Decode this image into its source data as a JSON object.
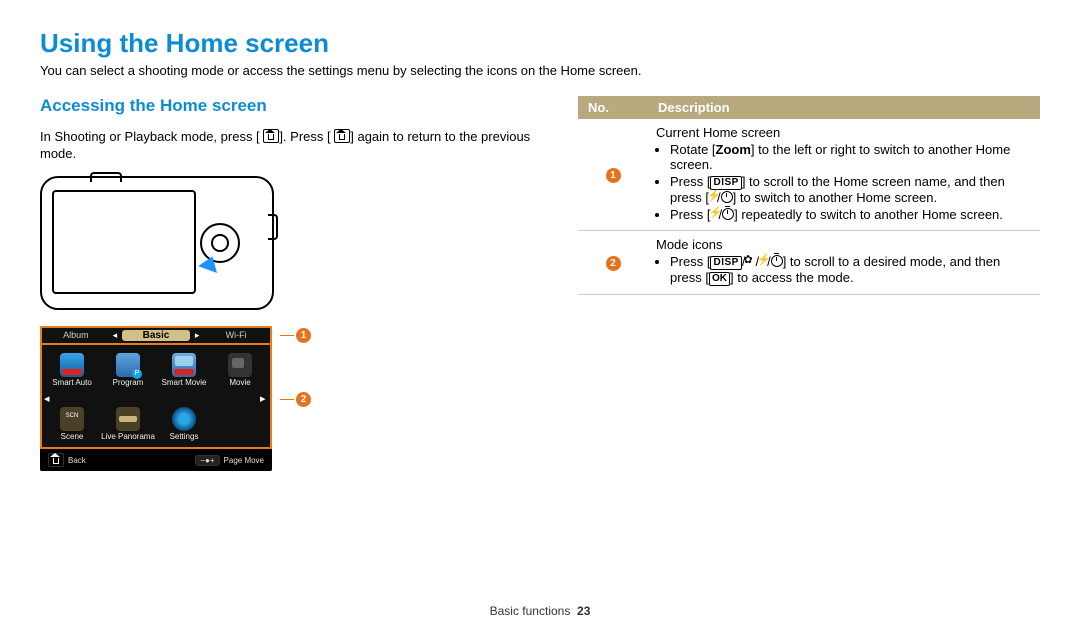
{
  "title": "Using the Home screen",
  "intro": "You can select a shooting mode or access the settings menu by selecting the icons on the Home screen.",
  "section_heading": "Accessing the Home screen",
  "access_text": {
    "pre": "In Shooting or Playback mode, press [",
    "mid": "]. Press [",
    "post": "] again to return to the previous mode."
  },
  "callouts": [
    "1",
    "2"
  ],
  "home_screen": {
    "tabs": [
      "Album",
      "Basic",
      "Wi-Fi"
    ],
    "row1": [
      "Smart Auto",
      "Program",
      "Smart Movie",
      "Movie"
    ],
    "row2": [
      "Scene",
      "Live\nPanorama",
      "Settings"
    ],
    "footer": {
      "back": "Back",
      "page_move": "Page Move"
    }
  },
  "symbols": {
    "disp": "DISP",
    "ok": "OK"
  },
  "table": {
    "headers": [
      "No.",
      "Description"
    ],
    "rows": [
      {
        "no": "1",
        "title": "Current Home screen",
        "b1a": "Rotate [",
        "zoom": "Zoom",
        "b1b": "] to the left or right to switch to another Home screen.",
        "b2a": "Press [",
        "b2b": "] to scroll to the Home screen name, and then press [",
        "b2c": "] to switch to another Home screen.",
        "b3a": "Press [",
        "b3b": "] repeatedly to switch to another Home screen."
      },
      {
        "no": "2",
        "title": "Mode icons",
        "b1a": "Press [",
        "b1b": "] to scroll to a desired mode, and then press [",
        "b1c": "] to access the mode."
      }
    ]
  },
  "footer": {
    "section": "Basic functions",
    "page": "23"
  }
}
